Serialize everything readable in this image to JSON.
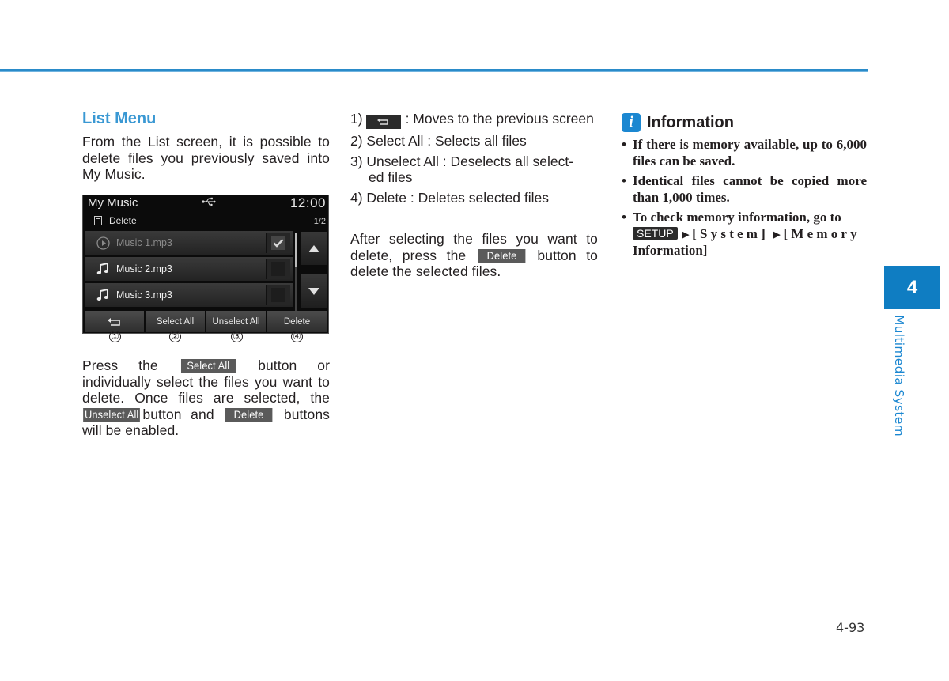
{
  "colors": {
    "accent": "#2a8bc9",
    "heading": "#3a98d3",
    "chapter_tab": "#0f7dc2",
    "info_icon": "#1b87d1"
  },
  "section": {
    "title": "List Menu",
    "intro": "From the List screen, it is possible to delete files you previously saved into My Music."
  },
  "screen": {
    "title": "My Music",
    "usb_icon": "usb-icon",
    "time": "12:00",
    "sub_label": "Delete",
    "page": "1/2",
    "files": [
      {
        "name": "Music 1.mp3",
        "icon": "play-circle-icon",
        "checked": true,
        "playing": true
      },
      {
        "name": "Music 2.mp3",
        "icon": "music-note-icon",
        "checked": false,
        "playing": false
      },
      {
        "name": "Music 3.mp3",
        "icon": "music-note-icon",
        "checked": false,
        "playing": false
      }
    ],
    "buttons": {
      "back": "back-icon",
      "select_all": "Select All",
      "unselect_all": "Unselect All",
      "delete": "Delete"
    },
    "callouts": [
      "①",
      "②",
      "③",
      "④"
    ]
  },
  "para2": {
    "p1": "Press the",
    "btn_select_all": "Select All",
    "p2": "button or individually select the files you want to delete. Once files are selected, the",
    "btn_unselect_all": "Unselect All",
    "p3": "button and",
    "btn_delete": "Delete",
    "p4": "buttons will be enabled."
  },
  "legend": {
    "item1_num": "1)",
    "item1_text": ": Moves to the previous screen",
    "item2": "2) Select All : Selects all files",
    "item3_a": "3) Unselect All : Deselects all select-",
    "item3_b": "ed files",
    "item4": "4) Delete : Deletes selected files"
  },
  "after": {
    "p1": "After selecting the files you want to delete, press the",
    "btn_delete": "Delete",
    "p2": "button to delete the selected files."
  },
  "info": {
    "title": "Information",
    "bullet1": "If there is memory available, up to 6,000 files can be saved.",
    "bullet2": "Identical files cannot be copied more than 1,000 times.",
    "bullet3_pre": "To check memory information, go to",
    "setup": "SETUP",
    "system": "[System]",
    "memory_a": "[Memory",
    "memory_b": "Information]"
  },
  "chapter": {
    "number": "4",
    "title": "Multimedia System"
  },
  "page_number": "4-93"
}
